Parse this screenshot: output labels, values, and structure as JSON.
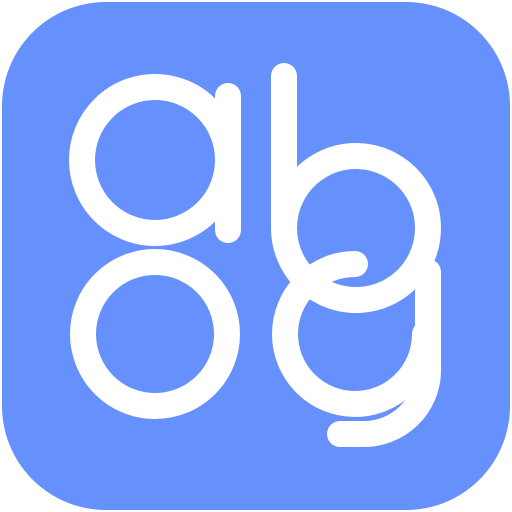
{
  "icon": {
    "name": "abog-app-icon",
    "glyphs": [
      "a",
      "b",
      "o",
      "g"
    ]
  },
  "colors": {
    "background": "#6690FC",
    "glyph": "#FFFFFF"
  }
}
